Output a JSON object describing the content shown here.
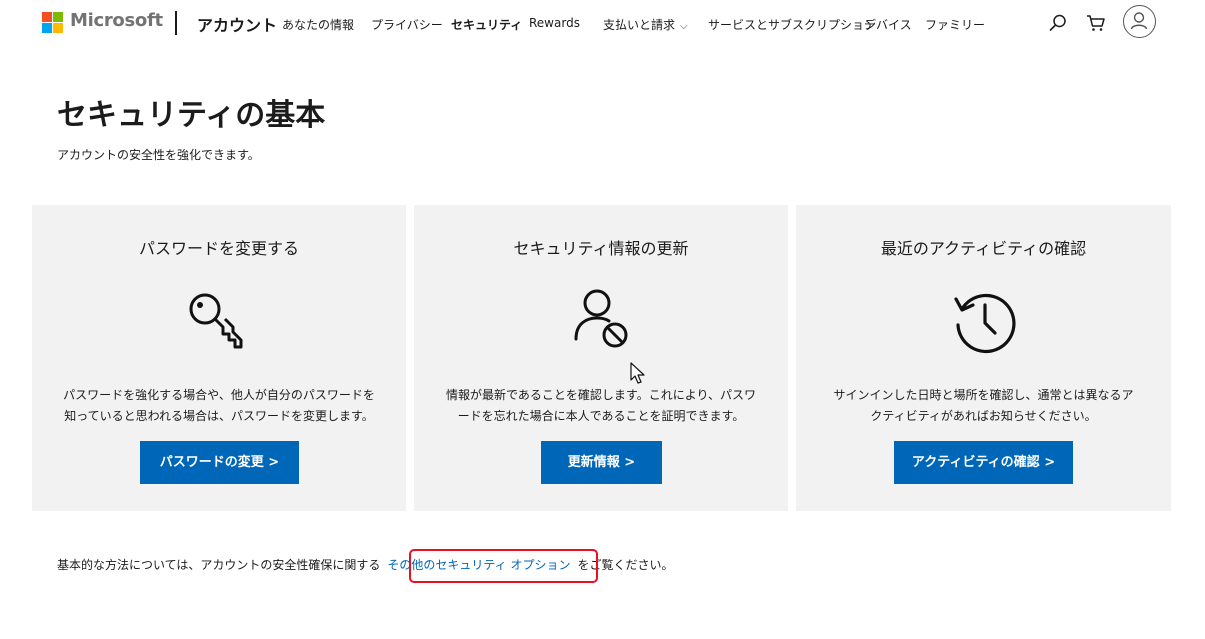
{
  "header": {
    "brand": "Microsoft",
    "section": "アカウント",
    "nav": [
      {
        "label": "あなたの情報"
      },
      {
        "label": "プライバシー"
      },
      {
        "label": "セキュリティ"
      },
      {
        "label": "Rewards"
      },
      {
        "label": "支払いと請求"
      },
      {
        "label": "サービスとサブスクリプション"
      },
      {
        "label": "デバイス"
      },
      {
        "label": "ファミリー"
      }
    ],
    "icons": [
      "search-icon",
      "cart-icon",
      "avatar-icon"
    ],
    "active_tab": "セキュリティ"
  },
  "page": {
    "title": "セキュリティの基本",
    "subtitle": "アカウントの安全性を強化できます。"
  },
  "cards": [
    {
      "title": "パスワードを変更する",
      "icon": "key-icon",
      "desc_line1": "パスワードを強化する場合や、他人が自分のパスワードを",
      "desc_line2": "知っていると思われる場合は、パスワードを変更します。",
      "button": "パスワードの変更 >"
    },
    {
      "title": "セキュリティ情報の更新",
      "icon": "person-block-icon",
      "desc_line1": "情報が最新であることを確認します。これにより、パスワ",
      "desc_line2": "ードを忘れた場合に本人であることを証明できます。",
      "button": "更新情報 >"
    },
    {
      "title": "最近のアクティビティの確認",
      "icon": "history-clock-icon",
      "desc_line1": "サインインした日時と場所を確認し、通常とは異なるア",
      "desc_line2": "クティビティがあればお知らせください。",
      "button": "アクティビティの確認 >"
    }
  ],
  "footer": {
    "before": "基本的な方法については、アカウントの安全性確保に関する",
    "link": "その他のセキュリティ オプション",
    "after": "をご覧ください。"
  },
  "colors": {
    "accent": "#0067b8",
    "card_bg": "#f2f2f2",
    "highlight": "#e81123"
  }
}
